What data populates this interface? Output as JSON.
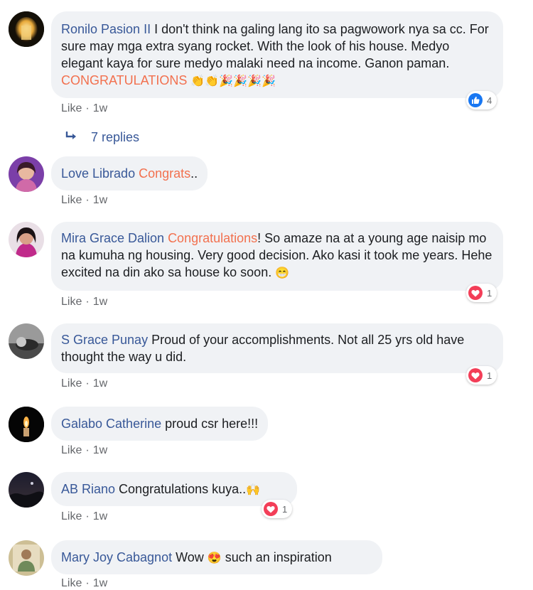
{
  "comments": [
    {
      "author": "Ronilo Pasion II",
      "text_1": " I don't think na galing lang ito sa pagwowork nya sa cc. For sure may mga extra syang rocket. With the look of his house. Medyo elegant kaya for sure medyo malaki need na income. Ganon paman. ",
      "highlight": "CONGRATULATIONS",
      "emojis": "👏👏🎉🎉🎉🎉",
      "like": "Like",
      "time": "1w",
      "reaction_icon": "like-icon",
      "reaction_count": "4",
      "replies": "7 replies"
    },
    {
      "author": "Love Librado",
      "highlight": "Congrats",
      "text_1": "..",
      "like": "Like",
      "time": "1w"
    },
    {
      "author": "Mira Grace Dalion",
      "highlight": "Congratulations",
      "text_1": "! So amaze na at a young age naisip mo na kumuha ng housing. Very good decision. Ako kasi it took me years. Hehe excited na din ako sa house ko soon. ",
      "emojis": "😁",
      "like": "Like",
      "time": "1w",
      "reaction_icon": "heart-icon",
      "reaction_count": "1"
    },
    {
      "author": "S Grace Punay",
      "text_1": " Proud of your accomplishments. Not all 25 yrs old have thought the way u did.",
      "like": "Like",
      "time": "1w",
      "reaction_icon": "heart-icon",
      "reaction_count": "1"
    },
    {
      "author": "Galabo Catherine",
      "text_1": " proud csr here!!!",
      "like": "Like",
      "time": "1w"
    },
    {
      "author": "AB Riano",
      "text_1": " Congratulations kuya..",
      "emojis": "🙌",
      "like": "Like",
      "time": "1w",
      "reaction_icon": "heart-icon",
      "reaction_count": "1"
    },
    {
      "author": "Mary Joy Cabagnot",
      "text_1": " Wow ",
      "emojis": "😍",
      "text_2": " such an inspiration",
      "like": "Like",
      "time": "1w"
    }
  ],
  "separator": "·"
}
